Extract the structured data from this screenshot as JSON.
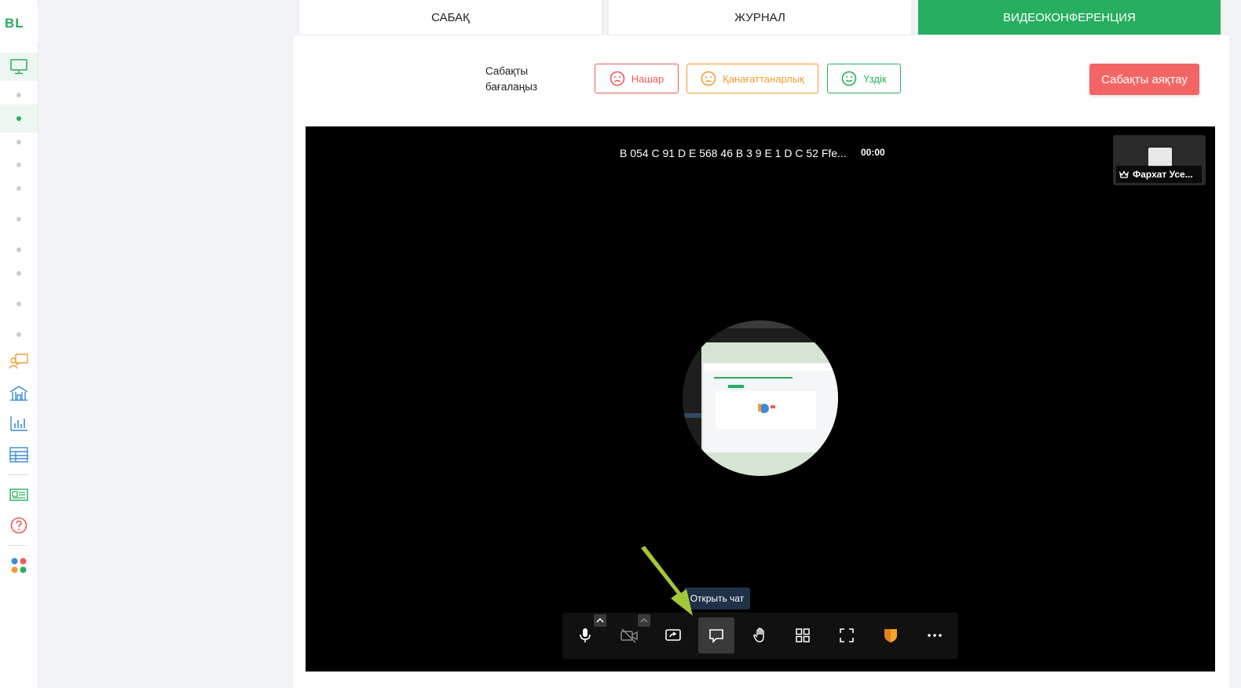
{
  "app": {
    "logo": "BL"
  },
  "tabs": [
    {
      "label": "САБАҚ"
    },
    {
      "label": "ЖУРНАЛ"
    },
    {
      "label": "ВИДЕОКОНФЕРЕНЦИЯ"
    }
  ],
  "rating": {
    "label_line1": "Сабақты",
    "label_line2": "бағалаңыз",
    "bad": "Нашар",
    "ok": "Қанағаттанарлық",
    "good": "Үздік"
  },
  "end_lesson": "Сабақты аяқтау",
  "video": {
    "meeting_title": "B 054 C 91 D E 568 46 B 3 9 E 1 D C 52 Ffe...",
    "timer": "00:00",
    "participant": "Фархат Усе..."
  },
  "tooltip": "Открыть чат",
  "colors": {
    "brand": "#27ae60",
    "danger": "#ee5a5a",
    "warning": "#f39c32"
  }
}
